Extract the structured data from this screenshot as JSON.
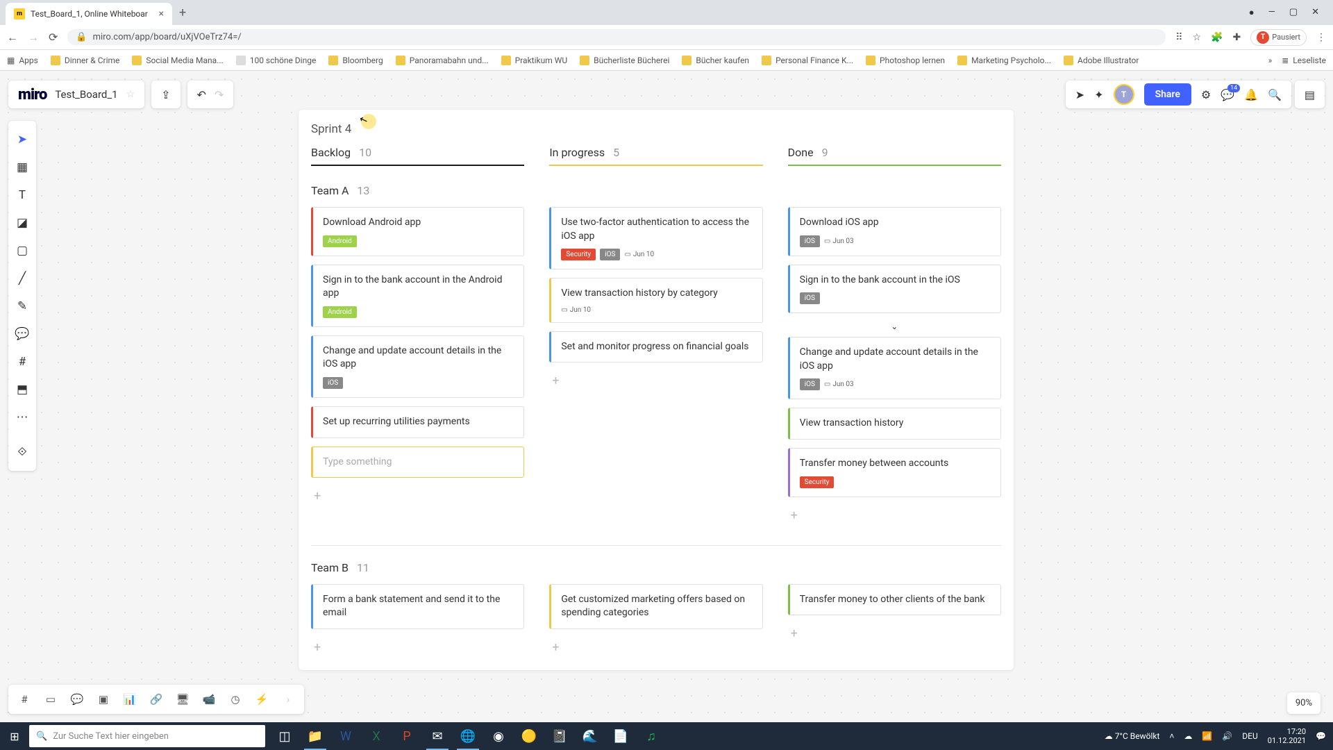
{
  "browser": {
    "tab_title": "Test_Board_1, Online Whiteboar",
    "url": "miro.com/app/board/uXjVOeTrz74=/",
    "profile_label": "Pausiert",
    "profile_initial": "T",
    "bookmarks": [
      "Apps",
      "Dinner & Crime",
      "Social Media Mana...",
      "100 schöne Dinge",
      "Bloomberg",
      "Panoramabahn und...",
      "Praktikum WU",
      "Bücherliste Bücherei",
      "Bücher kaufen",
      "Personal Finance K...",
      "Photoshop lernen",
      "Marketing Psycholo...",
      "Adobe Illustrator"
    ],
    "reading_list": "Leseliste"
  },
  "miro": {
    "logo": "miro",
    "board_name": "Test_Board_1",
    "share": "Share",
    "zoom": "90%"
  },
  "sprint": {
    "title": "Sprint 4",
    "columns": [
      {
        "label": "Backlog",
        "count": "10"
      },
      {
        "label": "In progress",
        "count": "5"
      },
      {
        "label": "Done",
        "count": "9"
      }
    ],
    "lanes": [
      {
        "label": "Team A",
        "count": "13",
        "cols": [
          [
            {
              "t": "Download Android app",
              "c": "red",
              "tags": [
                {
                  "k": "android",
                  "v": "Android"
                }
              ]
            },
            {
              "t": "Sign in to the bank account in the Android app",
              "c": "blue",
              "tags": [
                {
                  "k": "android",
                  "v": "Android"
                }
              ]
            },
            {
              "t": "Change and update account details in the iOS app",
              "c": "blue",
              "tags": [
                {
                  "k": "ios",
                  "v": "iOS"
                }
              ]
            },
            {
              "t": "Set up recurring utilities payments",
              "c": "red",
              "tags": []
            },
            {
              "t": "Type something",
              "c": "placeholder",
              "tags": []
            }
          ],
          [
            {
              "t": "Use two-factor authentication to access the iOS app",
              "c": "blue",
              "tags": [
                {
                  "k": "security",
                  "v": "Security"
                },
                {
                  "k": "ios",
                  "v": "iOS"
                }
              ],
              "date": "Jun 10"
            },
            {
              "t": "View transaction history by category",
              "c": "yellow",
              "tags": [],
              "date": "Jun 10"
            },
            {
              "t": "Set and monitor progress on financial goals",
              "c": "blue",
              "tags": []
            }
          ],
          [
            {
              "t": "Download iOS app",
              "c": "blue",
              "tags": [
                {
                  "k": "ios",
                  "v": "iOS"
                }
              ],
              "date": "Jun 03"
            },
            {
              "t": "Sign in to the bank account in the iOS",
              "c": "blue",
              "tags": [
                {
                  "k": "ios",
                  "v": "iOS"
                }
              ]
            },
            {
              "t": "Change and update account details in the iOS app",
              "c": "blue",
              "tags": [
                {
                  "k": "ios",
                  "v": "iOS"
                }
              ],
              "date": "Jun 03"
            },
            {
              "t": "View transaction history",
              "c": "green",
              "tags": []
            },
            {
              "t": "Transfer money between accounts",
              "c": "purple",
              "tags": [
                {
                  "k": "security",
                  "v": "Security"
                }
              ]
            }
          ]
        ]
      },
      {
        "label": "Team B",
        "count": "11",
        "cols": [
          [
            {
              "t": "Form a bank statement and send it to the email",
              "c": "blue",
              "tags": []
            }
          ],
          [
            {
              "t": "Get customized marketing offers based on spending categories",
              "c": "yellow",
              "tags": []
            }
          ],
          [
            {
              "t": "Transfer money to other clients of the bank",
              "c": "green",
              "tags": []
            }
          ]
        ]
      }
    ]
  },
  "taskbar": {
    "search_placeholder": "Zur Suche Text hier eingeben",
    "weather": "7°C Bewölkt",
    "lang": "DEU",
    "time": "17:20",
    "date": "01.12.2021"
  }
}
